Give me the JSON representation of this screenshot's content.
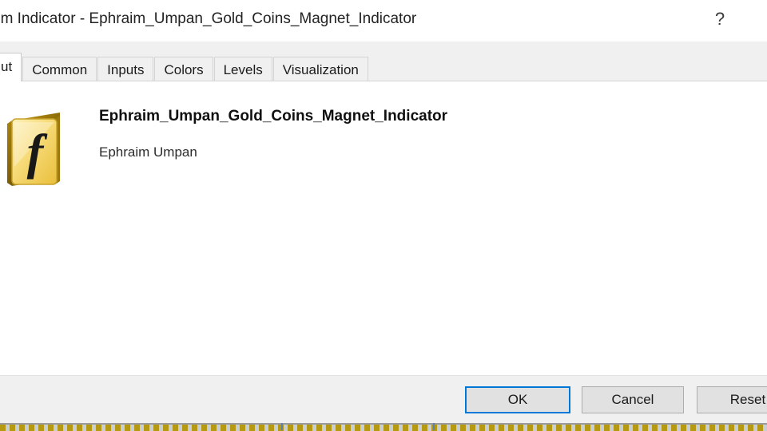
{
  "window": {
    "title": "om Indicator - Ephraim_Umpan_Gold_Coins_Magnet_Indicator",
    "help_label": "?"
  },
  "tabs": [
    {
      "label": "ut",
      "active": true,
      "clipped": true
    },
    {
      "label": "Common",
      "active": false,
      "clipped": false
    },
    {
      "label": "Inputs",
      "active": false,
      "clipped": false
    },
    {
      "label": "Colors",
      "active": false,
      "clipped": false
    },
    {
      "label": "Levels",
      "active": false,
      "clipped": false
    },
    {
      "label": "Visualization",
      "active": false,
      "clipped": false
    }
  ],
  "about": {
    "icon_name": "function-fx-icon",
    "indicator_name": "Ephraim_Umpan_Gold_Coins_Magnet_Indicator",
    "author": "Ephraim Umpan"
  },
  "footer": {
    "ok_label": "OK",
    "cancel_label": "Cancel",
    "reset_label": "Reset"
  },
  "colors": {
    "accent": "#0078d7",
    "tab_strip": "#f0f0f0",
    "footer": "#f0f0f0",
    "content": "#ffffff",
    "icon_gold": "#f5d76e",
    "bottom_dash_gold": "#b59a11"
  }
}
